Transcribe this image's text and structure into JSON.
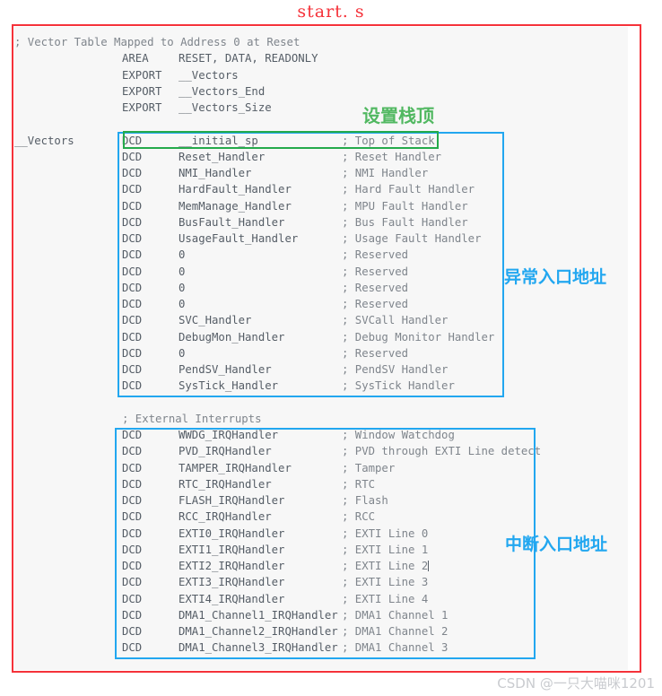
{
  "title": "start. s",
  "watermark": "CSDN @一只大喵咪1201",
  "annotations": {
    "stack_top": "设置栈顶",
    "exception_entry": "异常入口地址",
    "interrupt_entry": "中断入口地址"
  },
  "colors": {
    "frame_red": "#f5323a",
    "box_blue": "#22a7f0",
    "box_green": "#25aa4b",
    "code_text": "#555d66",
    "comment_text": "#7f858c",
    "code_background": "#f7f7f7",
    "annotation_green": "#51b861",
    "watermark": "#c9cbcf"
  },
  "code": {
    "language": "arm-assembly",
    "lines": [
      {
        "label": "",
        "mnemonic": "",
        "operand": "",
        "comment": "; Vector Table Mapped to Address 0 at Reset",
        "full_comment_line": true
      },
      {
        "label": "",
        "mnemonic": "AREA",
        "operand": "RESET, DATA, READONLY",
        "comment": ""
      },
      {
        "label": "",
        "mnemonic": "EXPORT",
        "operand": "__Vectors",
        "comment": ""
      },
      {
        "label": "",
        "mnemonic": "EXPORT",
        "operand": "__Vectors_End",
        "comment": ""
      },
      {
        "label": "",
        "mnemonic": "EXPORT",
        "operand": "__Vectors_Size",
        "comment": ""
      },
      {
        "blank": true
      },
      {
        "label": "__Vectors",
        "mnemonic": "DCD",
        "operand": "__initial_sp",
        "comment": "; Top of Stack"
      },
      {
        "label": "",
        "mnemonic": "DCD",
        "operand": "Reset_Handler",
        "comment": "; Reset Handler"
      },
      {
        "label": "",
        "mnemonic": "DCD",
        "operand": "NMI_Handler",
        "comment": "; NMI Handler"
      },
      {
        "label": "",
        "mnemonic": "DCD",
        "operand": "HardFault_Handler",
        "comment": "; Hard Fault Handler"
      },
      {
        "label": "",
        "mnemonic": "DCD",
        "operand": "MemManage_Handler",
        "comment": "; MPU Fault Handler"
      },
      {
        "label": "",
        "mnemonic": "DCD",
        "operand": "BusFault_Handler",
        "comment": "; Bus Fault Handler"
      },
      {
        "label": "",
        "mnemonic": "DCD",
        "operand": "UsageFault_Handler",
        "comment": "; Usage Fault Handler"
      },
      {
        "label": "",
        "mnemonic": "DCD",
        "operand": "0",
        "comment": "; Reserved"
      },
      {
        "label": "",
        "mnemonic": "DCD",
        "operand": "0",
        "comment": "; Reserved"
      },
      {
        "label": "",
        "mnemonic": "DCD",
        "operand": "0",
        "comment": "; Reserved"
      },
      {
        "label": "",
        "mnemonic": "DCD",
        "operand": "0",
        "comment": "; Reserved"
      },
      {
        "label": "",
        "mnemonic": "DCD",
        "operand": "SVC_Handler",
        "comment": "; SVCall Handler"
      },
      {
        "label": "",
        "mnemonic": "DCD",
        "operand": "DebugMon_Handler",
        "comment": "; Debug Monitor Handler"
      },
      {
        "label": "",
        "mnemonic": "DCD",
        "operand": "0",
        "comment": "; Reserved"
      },
      {
        "label": "",
        "mnemonic": "DCD",
        "operand": "PendSV_Handler",
        "comment": "; PendSV Handler"
      },
      {
        "label": "",
        "mnemonic": "DCD",
        "operand": "SysTick_Handler",
        "comment": "; SysTick Handler"
      },
      {
        "blank": true
      },
      {
        "label": "",
        "mnemonic": "",
        "operand": "",
        "comment": "; External Interrupts",
        "indented_comment": true
      },
      {
        "label": "",
        "mnemonic": "DCD",
        "operand": "WWDG_IRQHandler",
        "comment": "; Window Watchdog"
      },
      {
        "label": "",
        "mnemonic": "DCD",
        "operand": "PVD_IRQHandler",
        "comment": "; PVD through EXTI Line detect"
      },
      {
        "label": "",
        "mnemonic": "DCD",
        "operand": "TAMPER_IRQHandler",
        "comment": "; Tamper"
      },
      {
        "label": "",
        "mnemonic": "DCD",
        "operand": "RTC_IRQHandler",
        "comment": "; RTC"
      },
      {
        "label": "",
        "mnemonic": "DCD",
        "operand": "FLASH_IRQHandler",
        "comment": "; Flash"
      },
      {
        "label": "",
        "mnemonic": "DCD",
        "operand": "RCC_IRQHandler",
        "comment": "; RCC"
      },
      {
        "label": "",
        "mnemonic": "DCD",
        "operand": "EXTI0_IRQHandler",
        "comment": "; EXTI Line 0"
      },
      {
        "label": "",
        "mnemonic": "DCD",
        "operand": "EXTI1_IRQHandler",
        "comment": "; EXTI Line 1"
      },
      {
        "label": "",
        "mnemonic": "DCD",
        "operand": "EXTI2_IRQHandler",
        "comment": "; EXTI Line 2",
        "caret": true
      },
      {
        "label": "",
        "mnemonic": "DCD",
        "operand": "EXTI3_IRQHandler",
        "comment": "; EXTI Line 3"
      },
      {
        "label": "",
        "mnemonic": "DCD",
        "operand": "EXTI4_IRQHandler",
        "comment": "; EXTI Line 4"
      },
      {
        "label": "",
        "mnemonic": "DCD",
        "operand": "DMA1_Channel1_IRQHandler",
        "comment": "; DMA1 Channel 1"
      },
      {
        "label": "",
        "mnemonic": "DCD",
        "operand": "DMA1_Channel2_IRQHandler",
        "comment": "; DMA1 Channel 2"
      },
      {
        "label": "",
        "mnemonic": "DCD",
        "operand": "DMA1_Channel3_IRQHandler",
        "comment": "; DMA1 Channel 3"
      }
    ]
  }
}
